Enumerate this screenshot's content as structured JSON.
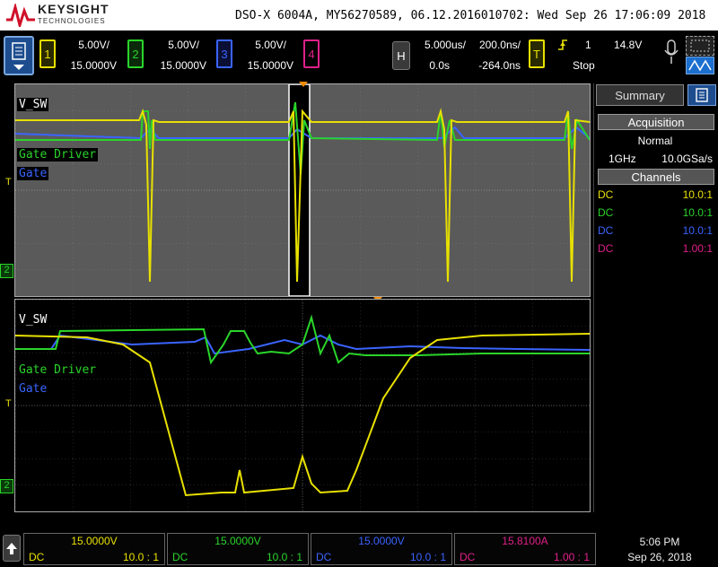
{
  "header": {
    "brand": "KEYSIGHT",
    "brand_sub": "TECHNOLOGIES",
    "title": "DSO-X 6004A, MY56270589, 06.12.2016010702: Wed Sep 26 17:06:09 2018"
  },
  "channels": [
    {
      "num": "1",
      "scale": "5.00V/",
      "offset": "15.0000V",
      "color": "#e8e000"
    },
    {
      "num": "2",
      "scale": "5.00V/",
      "offset": "15.0000V",
      "color": "#2ad42a"
    },
    {
      "num": "3",
      "scale": "5.00V/",
      "offset": "15.0000V",
      "color": "#3a64ff"
    },
    {
      "num": "4",
      "scale": "",
      "offset": "",
      "color": "#e0208a"
    }
  ],
  "horizontal": {
    "button": "H",
    "main_scale": "5.000us/",
    "main_delay": "0.0s",
    "zoom_scale": "200.0ns/",
    "zoom_delay": "-264.0ns"
  },
  "trigger": {
    "button": "T",
    "source": "1",
    "level": "14.8V",
    "state": "Stop"
  },
  "waveform_labels": {
    "vsw": "V_SW",
    "gate_driver": "Gate Driver",
    "gate": "Gate"
  },
  "sidebar": {
    "tab": "Summary",
    "acq_head": "Acquisition",
    "acq_mode": "Normal",
    "acq_bw": "1GHz",
    "acq_rate": "10.0GSa/s",
    "chan_head": "Channels",
    "rows": [
      {
        "coupling": "DC",
        "probe": "10.0:1",
        "color": "#e8e000"
      },
      {
        "coupling": "DC",
        "probe": "10.0:1",
        "color": "#2ad42a"
      },
      {
        "coupling": "DC",
        "probe": "10.0:1",
        "color": "#3a64ff"
      },
      {
        "coupling": "DC",
        "probe": "1.00:1",
        "color": "#e0208a"
      }
    ]
  },
  "bottom": [
    {
      "value": "15.0000V",
      "coupling": "DC",
      "probe": "10.0 : 1",
      "color": "#e8e000"
    },
    {
      "value": "15.0000V",
      "coupling": "DC",
      "probe": "10.0 : 1",
      "color": "#2ad42a"
    },
    {
      "value": "15.0000V",
      "coupling": "DC",
      "probe": "10.0 : 1",
      "color": "#3a64ff"
    },
    {
      "value": "15.8100A",
      "coupling": "DC",
      "probe": "1.00 : 1",
      "color": "#e0208a"
    }
  ],
  "clock": {
    "time": "5:06 PM",
    "date": "Sep 26, 2018"
  },
  "markers": {
    "trigger_level": "T",
    "ground_2": "2"
  }
}
